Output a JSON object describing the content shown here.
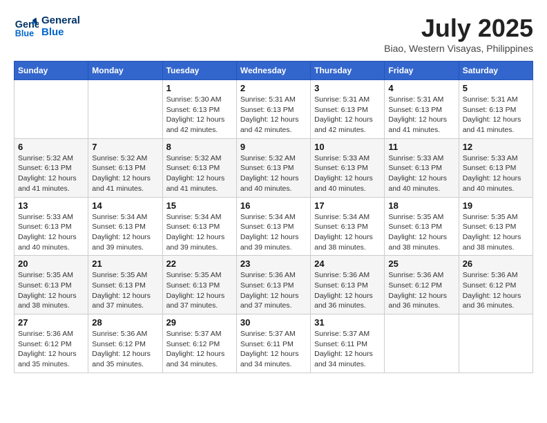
{
  "logo": {
    "line1": "General",
    "line2": "Blue"
  },
  "title": "July 2025",
  "location": "Biao, Western Visayas, Philippines",
  "weekdays": [
    "Sunday",
    "Monday",
    "Tuesday",
    "Wednesday",
    "Thursday",
    "Friday",
    "Saturday"
  ],
  "weeks": [
    [
      null,
      null,
      {
        "day": 1,
        "sunrise": "5:30 AM",
        "sunset": "6:13 PM",
        "daylight": "12 hours and 42 minutes."
      },
      {
        "day": 2,
        "sunrise": "5:31 AM",
        "sunset": "6:13 PM",
        "daylight": "12 hours and 42 minutes."
      },
      {
        "day": 3,
        "sunrise": "5:31 AM",
        "sunset": "6:13 PM",
        "daylight": "12 hours and 42 minutes."
      },
      {
        "day": 4,
        "sunrise": "5:31 AM",
        "sunset": "6:13 PM",
        "daylight": "12 hours and 41 minutes."
      },
      {
        "day": 5,
        "sunrise": "5:31 AM",
        "sunset": "6:13 PM",
        "daylight": "12 hours and 41 minutes."
      }
    ],
    [
      {
        "day": 6,
        "sunrise": "5:32 AM",
        "sunset": "6:13 PM",
        "daylight": "12 hours and 41 minutes."
      },
      {
        "day": 7,
        "sunrise": "5:32 AM",
        "sunset": "6:13 PM",
        "daylight": "12 hours and 41 minutes."
      },
      {
        "day": 8,
        "sunrise": "5:32 AM",
        "sunset": "6:13 PM",
        "daylight": "12 hours and 41 minutes."
      },
      {
        "day": 9,
        "sunrise": "5:32 AM",
        "sunset": "6:13 PM",
        "daylight": "12 hours and 40 minutes."
      },
      {
        "day": 10,
        "sunrise": "5:33 AM",
        "sunset": "6:13 PM",
        "daylight": "12 hours and 40 minutes."
      },
      {
        "day": 11,
        "sunrise": "5:33 AM",
        "sunset": "6:13 PM",
        "daylight": "12 hours and 40 minutes."
      },
      {
        "day": 12,
        "sunrise": "5:33 AM",
        "sunset": "6:13 PM",
        "daylight": "12 hours and 40 minutes."
      }
    ],
    [
      {
        "day": 13,
        "sunrise": "5:33 AM",
        "sunset": "6:13 PM",
        "daylight": "12 hours and 40 minutes."
      },
      {
        "day": 14,
        "sunrise": "5:34 AM",
        "sunset": "6:13 PM",
        "daylight": "12 hours and 39 minutes."
      },
      {
        "day": 15,
        "sunrise": "5:34 AM",
        "sunset": "6:13 PM",
        "daylight": "12 hours and 39 minutes."
      },
      {
        "day": 16,
        "sunrise": "5:34 AM",
        "sunset": "6:13 PM",
        "daylight": "12 hours and 39 minutes."
      },
      {
        "day": 17,
        "sunrise": "5:34 AM",
        "sunset": "6:13 PM",
        "daylight": "12 hours and 38 minutes."
      },
      {
        "day": 18,
        "sunrise": "5:35 AM",
        "sunset": "6:13 PM",
        "daylight": "12 hours and 38 minutes."
      },
      {
        "day": 19,
        "sunrise": "5:35 AM",
        "sunset": "6:13 PM",
        "daylight": "12 hours and 38 minutes."
      }
    ],
    [
      {
        "day": 20,
        "sunrise": "5:35 AM",
        "sunset": "6:13 PM",
        "daylight": "12 hours and 38 minutes."
      },
      {
        "day": 21,
        "sunrise": "5:35 AM",
        "sunset": "6:13 PM",
        "daylight": "12 hours and 37 minutes."
      },
      {
        "day": 22,
        "sunrise": "5:35 AM",
        "sunset": "6:13 PM",
        "daylight": "12 hours and 37 minutes."
      },
      {
        "day": 23,
        "sunrise": "5:36 AM",
        "sunset": "6:13 PM",
        "daylight": "12 hours and 37 minutes."
      },
      {
        "day": 24,
        "sunrise": "5:36 AM",
        "sunset": "6:13 PM",
        "daylight": "12 hours and 36 minutes."
      },
      {
        "day": 25,
        "sunrise": "5:36 AM",
        "sunset": "6:12 PM",
        "daylight": "12 hours and 36 minutes."
      },
      {
        "day": 26,
        "sunrise": "5:36 AM",
        "sunset": "6:12 PM",
        "daylight": "12 hours and 36 minutes."
      }
    ],
    [
      {
        "day": 27,
        "sunrise": "5:36 AM",
        "sunset": "6:12 PM",
        "daylight": "12 hours and 35 minutes."
      },
      {
        "day": 28,
        "sunrise": "5:36 AM",
        "sunset": "6:12 PM",
        "daylight": "12 hours and 35 minutes."
      },
      {
        "day": 29,
        "sunrise": "5:37 AM",
        "sunset": "6:12 PM",
        "daylight": "12 hours and 34 minutes."
      },
      {
        "day": 30,
        "sunrise": "5:37 AM",
        "sunset": "6:11 PM",
        "daylight": "12 hours and 34 minutes."
      },
      {
        "day": 31,
        "sunrise": "5:37 AM",
        "sunset": "6:11 PM",
        "daylight": "12 hours and 34 minutes."
      },
      null,
      null
    ]
  ],
  "labels": {
    "sunrise": "Sunrise:",
    "sunset": "Sunset:",
    "daylight": "Daylight:"
  }
}
